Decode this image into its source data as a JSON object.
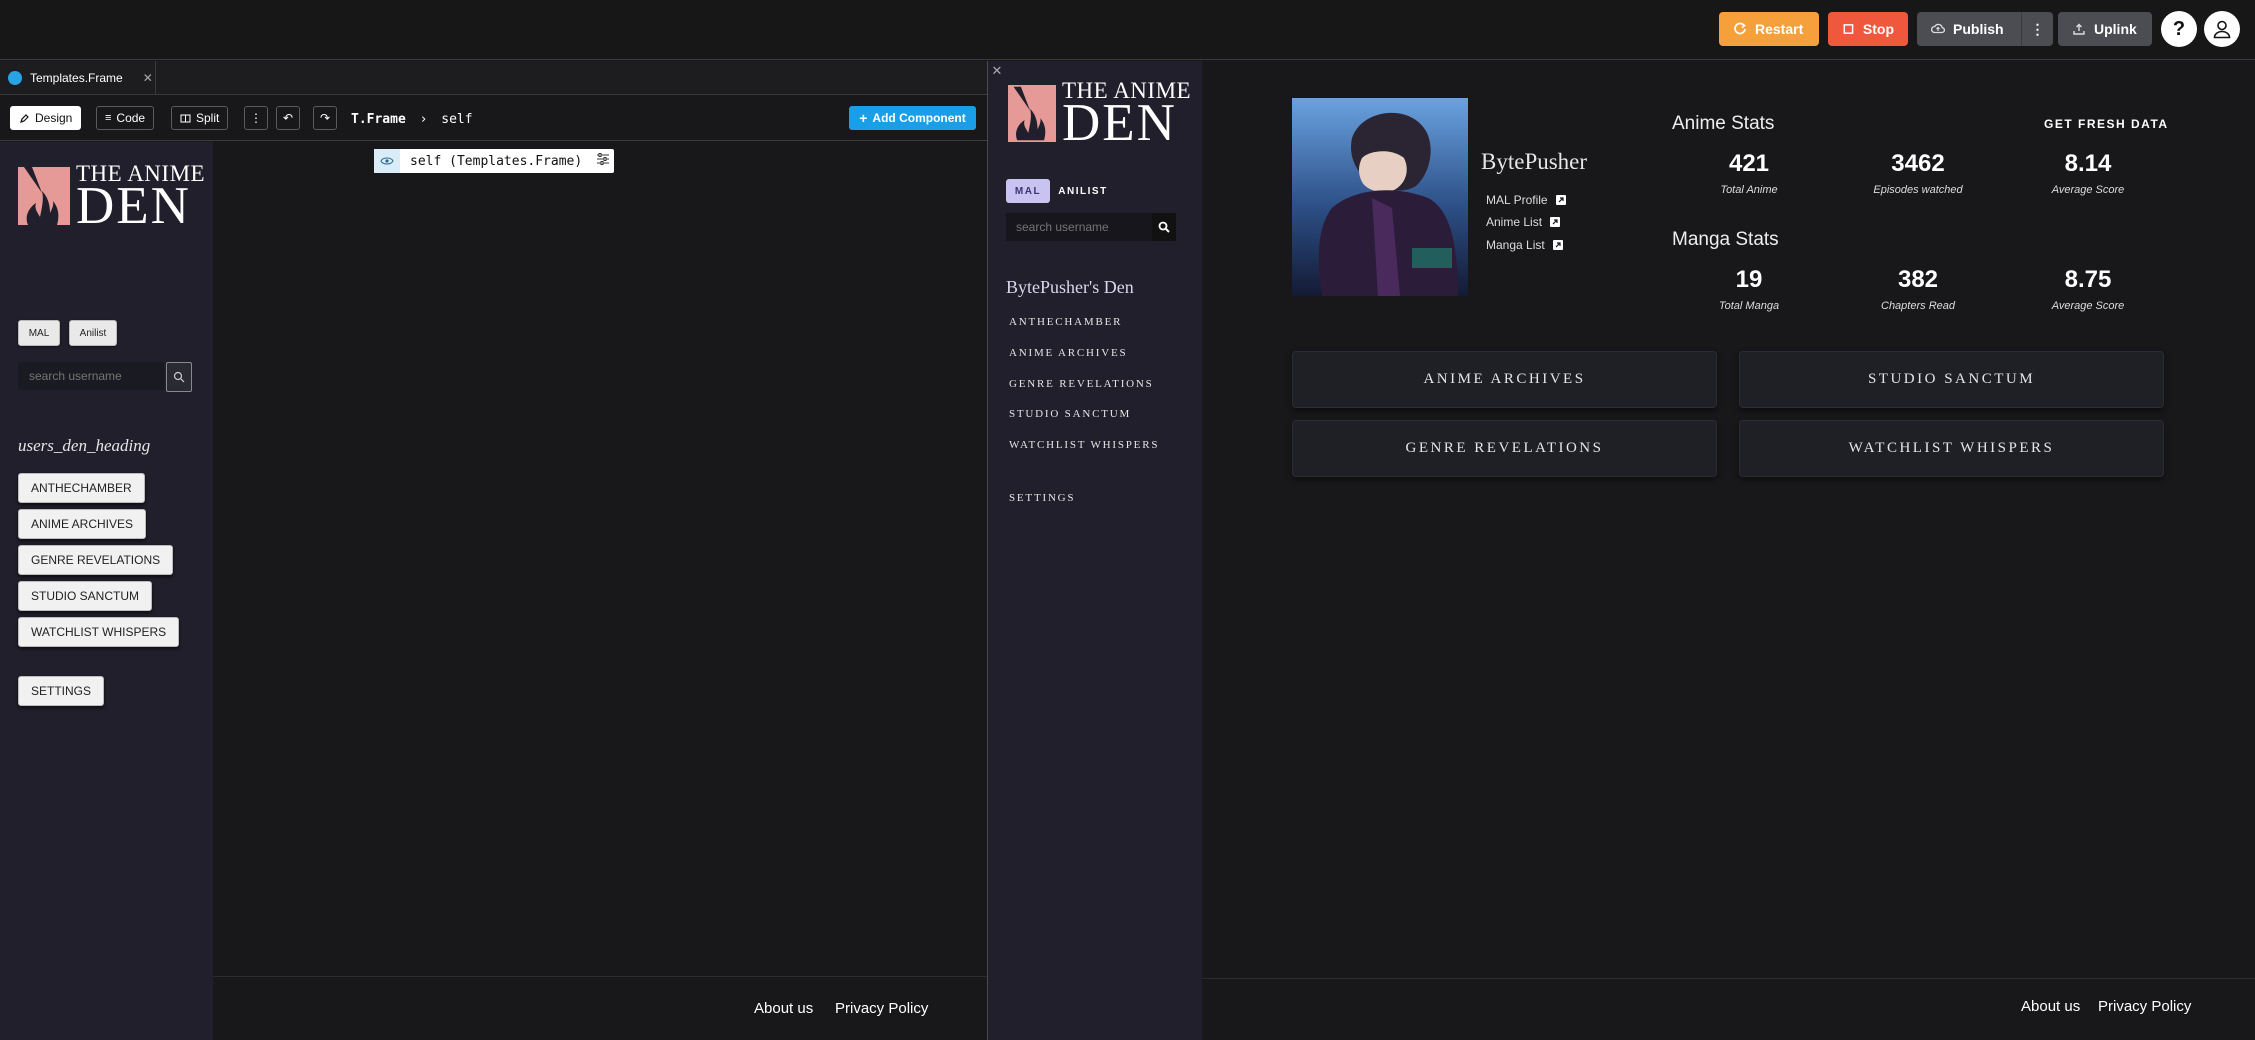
{
  "topbar": {
    "restart": "Restart",
    "stop": "Stop",
    "publish": "Publish",
    "uplink": "Uplink",
    "help": "?",
    "colors": {
      "restart": "#f5a03a",
      "stop": "#f0583d",
      "neutral": "#4b4d52"
    }
  },
  "editor": {
    "tab_label": "Templates.Frame",
    "toolbar": {
      "design": "Design",
      "code": "Code",
      "split": "Split",
      "crumb_root": "T.Frame",
      "crumb_sep": "›",
      "crumb_child": "self",
      "add_component": "Add Component"
    },
    "canvas_chip": "self (Templates.Frame)",
    "sidebar": {
      "logo_line1": "THE ANIME",
      "logo_line2": "DEN",
      "mal": "MAL",
      "anilist": "Anilist",
      "search_placeholder": "search username",
      "heading": "users_den_heading",
      "nav": [
        "ANTHECHAMBER",
        "ANIME ARCHIVES",
        "GENRE REVELATIONS",
        "STUDIO SANCTUM",
        "WATCHLIST WHISPERS"
      ],
      "settings": "SETTINGS"
    },
    "footer": {
      "about": "About us",
      "privacy": "Privacy Policy"
    }
  },
  "preview": {
    "sidebar": {
      "logo_line1": "THE ANIME",
      "logo_line2": "DEN",
      "mal": "MAL",
      "anilist": "ANILIST",
      "search_placeholder": "search username",
      "heading": "BytePusher's Den",
      "nav": [
        "ANTHECHAMBER",
        "ANIME ARCHIVES",
        "GENRE REVELATIONS",
        "STUDIO SANCTUM",
        "WATCHLIST WHISPERS"
      ],
      "settings": "SETTINGS"
    },
    "profile": {
      "username": "BytePusher",
      "links": [
        "MAL Profile",
        "Anime List",
        "Manga List"
      ]
    },
    "stats": {
      "fresh": "GET FRESH DATA",
      "anime_title": "Anime Stats",
      "anime": [
        {
          "value": "421",
          "label": "Total Anime"
        },
        {
          "value": "3462",
          "label": "Episodes watched"
        },
        {
          "value": "8.14",
          "label": "Average Score"
        }
      ],
      "manga_title": "Manga Stats",
      "manga": [
        {
          "value": "19",
          "label": "Total Manga"
        },
        {
          "value": "382",
          "label": "Chapters Read"
        },
        {
          "value": "8.75",
          "label": "Average Score"
        }
      ]
    },
    "cards": [
      "ANIME ARCHIVES",
      "STUDIO SANCTUM",
      "GENRE REVELATIONS",
      "WATCHLIST WHISPERS"
    ],
    "footer": {
      "about": "About us",
      "privacy": "Privacy Policy"
    }
  }
}
